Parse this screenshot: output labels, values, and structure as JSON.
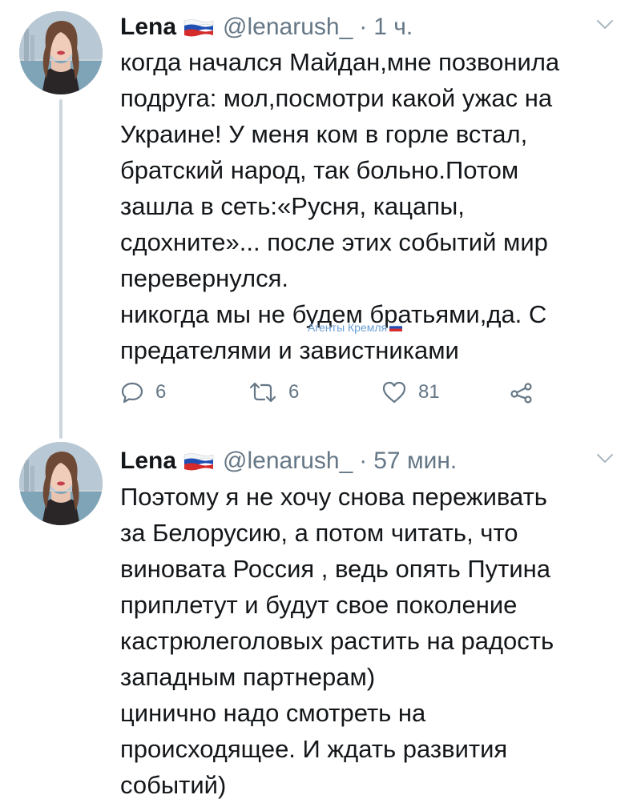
{
  "colors": {
    "text": "#14171a",
    "secondary": "#657786",
    "thread_line": "#ccd6dd",
    "watermark": "#6b9fd6"
  },
  "icons": {
    "flag": "russia-flag-icon",
    "caret": "chevron-down-icon",
    "reply": "reply-icon",
    "retweet": "retweet-icon",
    "like": "heart-icon",
    "share": "share-icon"
  },
  "watermark": {
    "text": "Агенты Кремля"
  },
  "tweets": [
    {
      "author_name": "Lena",
      "handle": "@lenarush_",
      "separator": "·",
      "time": "1 ч.",
      "lines": [
        "когда начался Майдан,мне позвонила",
        "подруга: мол,посмотри какой ужас на",
        "Украине! У меня ком в горле встал,",
        "братский народ, так больно.Потом",
        "зашла в сеть:«Русня, кацапы,",
        "сдохните»... после этих событий мир",
        "перевернулся.",
        "никогда мы не будем братьями,да. С",
        "предателями и завистниками"
      ],
      "reply_count": "6",
      "retweet_count": "6",
      "like_count": "81"
    },
    {
      "author_name": "Lena",
      "handle": "@lenarush_",
      "separator": "·",
      "time": "57 мин.",
      "lines": [
        "Поэтому я не хочу снова переживать",
        "за Белорусию, а потом читать, что",
        "виновата Россия , ведь опять Путина",
        "приплетут и будут свое поколение",
        "кастрюлеголовых растить на радость",
        "западным партнерам)",
        "цинично надо смотреть на",
        "происходящее. И ждать развития",
        "событий)"
      ]
    }
  ]
}
